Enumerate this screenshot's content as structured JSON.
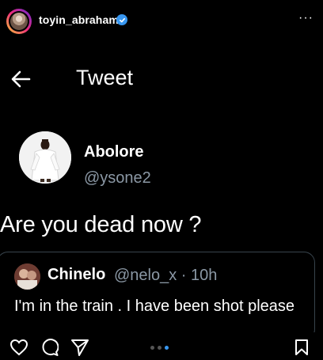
{
  "instagram": {
    "username": "toyin_abraham",
    "verified": true,
    "more_glyph": "···",
    "carousel": {
      "count": 3,
      "active_index": 2,
      "active_color": "#3897f0"
    }
  },
  "tweet_screen": {
    "title": "Tweet",
    "author": {
      "name": "Abolore",
      "handle": "@ysone2"
    },
    "text": "Are you dead now ?",
    "quoted": {
      "name": "Chinelo",
      "meta": "@nelo_x · 10h",
      "text": "I'm in the train .  I have been shot please"
    }
  },
  "colors": {
    "background": "#000000",
    "muted_text": "#8b98a5",
    "verified_blue": "#3897f0",
    "card_border": "#38444d"
  }
}
